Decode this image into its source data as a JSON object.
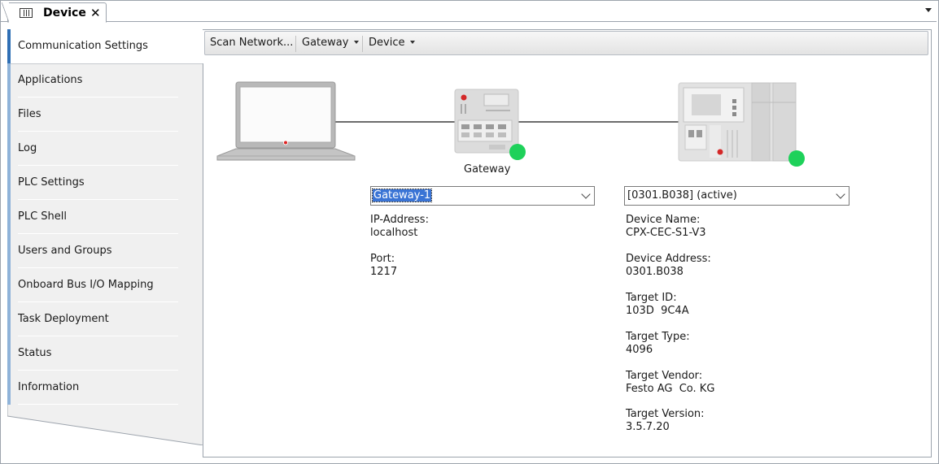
{
  "tab": {
    "title": "Device",
    "close": "✕",
    "icon": "device-editor-icon"
  },
  "sidebar": {
    "items": [
      {
        "label": "Communication Settings",
        "active": true
      },
      {
        "label": "Applications"
      },
      {
        "label": "Files"
      },
      {
        "label": "Log"
      },
      {
        "label": "PLC Settings"
      },
      {
        "label": "PLC Shell"
      },
      {
        "label": "Users and Groups"
      },
      {
        "label": "Onboard Bus I/O Mapping"
      },
      {
        "label": "Task Deployment"
      },
      {
        "label": "Status"
      },
      {
        "label": "Information"
      }
    ]
  },
  "toolbar": {
    "scan": "Scan Network...",
    "gateway": "Gateway",
    "device": "Device"
  },
  "diagram": {
    "gateway_label": "Gateway",
    "status_color": "#1ed15a"
  },
  "gateway": {
    "selected": "Gateway-1",
    "ip_label": "IP-Address:",
    "ip_value": "localhost",
    "port_label": "Port:",
    "port_value": "1217"
  },
  "device": {
    "selected": "[0301.B038] (active)",
    "fields": [
      {
        "label": "Device Name:",
        "value": "CPX-CEC-S1-V3"
      },
      {
        "label": "Device Address:",
        "value": "0301.B038"
      },
      {
        "label": "Target ID:",
        "value": "103D  9C4A"
      },
      {
        "label": "Target Type:",
        "value": "4096"
      },
      {
        "label": "Target Vendor:",
        "value": "Festo AG  Co. KG"
      },
      {
        "label": "Target Version:",
        "value": "3.5.7.20"
      }
    ]
  }
}
